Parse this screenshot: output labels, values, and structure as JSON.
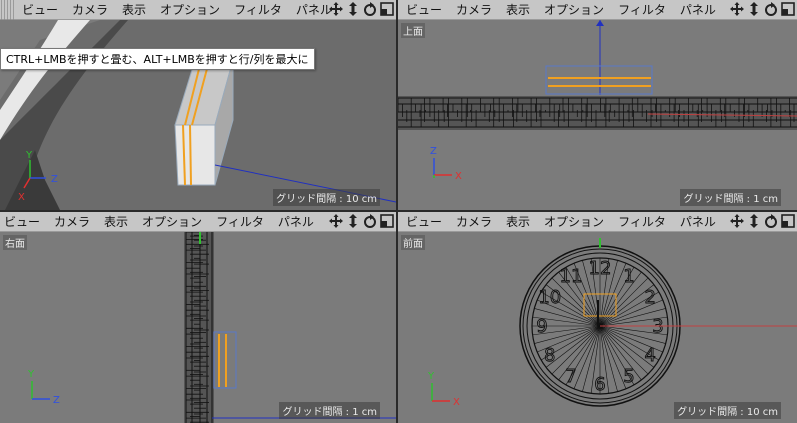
{
  "menu": [
    "ビュー",
    "カメラ",
    "表示",
    "オプション",
    "フィルタ",
    "パネル"
  ],
  "nav_icons": [
    "move-icon",
    "scale-icon",
    "rotate-icon",
    "toggle-view-icon"
  ],
  "tooltip": "CTRL+LMBを押すと畳む、ALT+LMBを押すと行/列を最大に",
  "views": {
    "perspective": {
      "grid": "グリッド間隔 : 10 cm"
    },
    "top": {
      "title": "上面",
      "grid": "グリッド間隔 : 1 cm"
    },
    "right": {
      "title": "右面",
      "grid": "グリッド間隔 : 1 cm"
    },
    "front": {
      "title": "前面",
      "grid": "グリッド間隔 : 10 cm"
    }
  },
  "axes": {
    "x": "X",
    "y": "Y",
    "z": "Z"
  },
  "clock_numerals": [
    "12",
    "1",
    "2",
    "3",
    "4",
    "5",
    "6",
    "7",
    "8",
    "9",
    "10",
    "11"
  ],
  "colors": {
    "accent_orange": "#f0a020",
    "axis_x": "#e03030",
    "axis_y": "#30c030",
    "axis_z": "#3050e0",
    "selection_blue": "#3a6ad8"
  }
}
